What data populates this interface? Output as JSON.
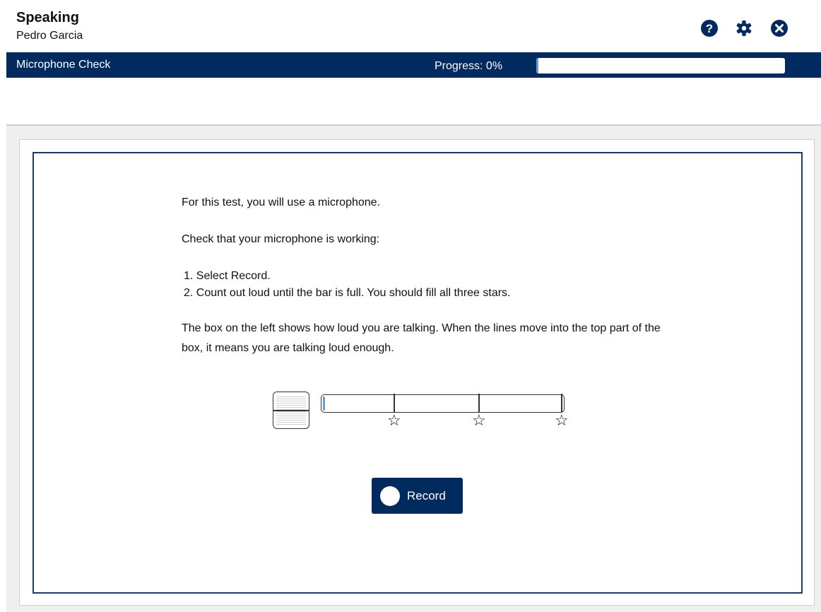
{
  "header": {
    "title": "Speaking",
    "user": "Pedro Garcia",
    "icons": [
      "help-icon",
      "gear-icon",
      "close-icon"
    ]
  },
  "navbar": {
    "section": "Microphone Check",
    "progress_label": "Progress: 0%",
    "progress_fraction": 0.0
  },
  "instructions": {
    "intro": "For this test, you will use a microphone.",
    "check": "Check that your microphone is working:",
    "steps": [
      "1. Select Record.",
      "2. Count out loud until the bar is full. You should fill all three stars."
    ],
    "explanation": "The box on the left shows how loud you are talking. When the lines move into the top part of the box, it means you are talking loud enough."
  },
  "meter": {
    "level_fraction": 0.0,
    "star_icons": [
      "star-icon",
      "star-icon",
      "star-icon"
    ]
  },
  "record_button": {
    "label": "Record"
  },
  "colors": {
    "brand": "#012a5e",
    "progress_fill": "#6a9bd4",
    "background": "#efefef"
  }
}
